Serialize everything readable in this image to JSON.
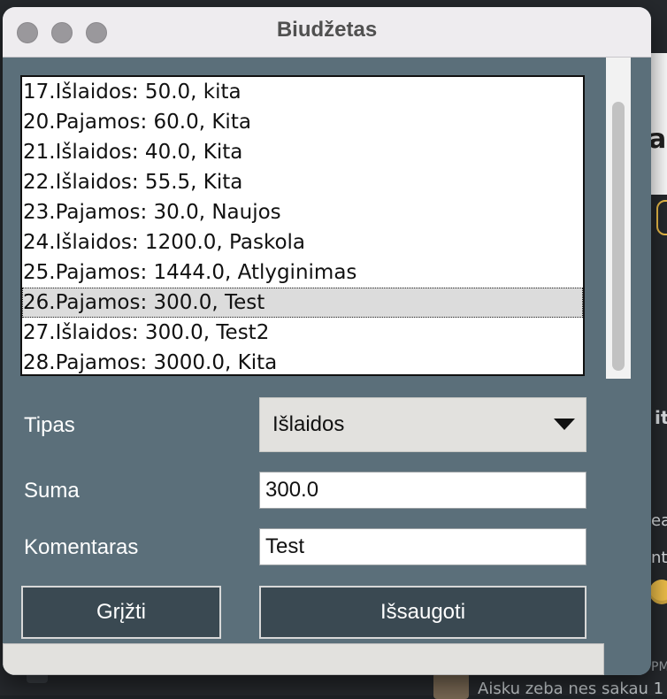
{
  "window": {
    "title": "Biudžetas"
  },
  "list": {
    "items": [
      "17.Išlaidos: 50.0, kita",
      "20.Pajamos: 60.0, Kita",
      "21.Išlaidos: 40.0, Kita",
      "22.Išlaidos: 55.5, Kita",
      "23.Pajamos: 30.0, Naujos",
      "24.Išlaidos: 1200.0, Paskola",
      "25.Pajamos: 1444.0, Atlyginimas",
      "26.Pajamos: 300.0, Test",
      "27.Išlaidos: 300.0, Test2",
      "28.Pajamos: 3000.0, Kita"
    ],
    "selected_index": 7
  },
  "form": {
    "type_label": "Tipas",
    "type_value": "Išlaidos",
    "amount_label": "Suma",
    "amount_value": "300.0",
    "comment_label": "Komentaras",
    "comment_value": "Test"
  },
  "buttons": {
    "back_label": "Grįžti",
    "save_label": "Išsaugoti"
  },
  "background": {
    "header_text": "a,",
    "side_text_1": "itė",
    "side_text_2": "eac",
    "side_text_3": "nt",
    "time_text": "PM",
    "message_text": "Aisku zeba nes sakau 1"
  }
}
